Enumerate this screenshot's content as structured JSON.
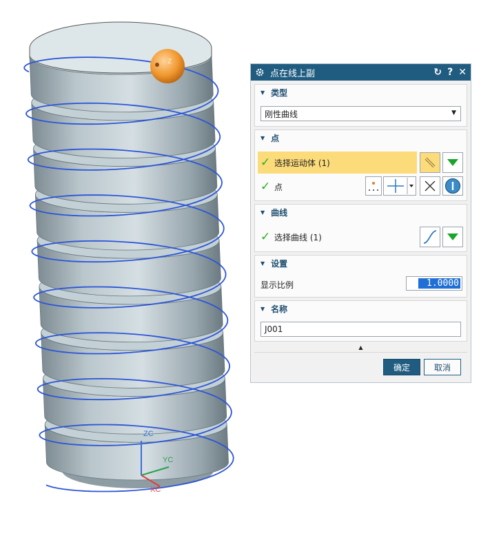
{
  "viewport": {
    "axes": {
      "z": "ZC",
      "y": "YC",
      "x": "XC"
    },
    "marker_text": "Z"
  },
  "dialog": {
    "title": "点在线上副",
    "title_icon": "gear-icon",
    "buttons": {
      "reset": "↻",
      "help": "?",
      "close": "✕"
    },
    "sections": {
      "type": {
        "header": "类型",
        "selected": "刚性曲线"
      },
      "point": {
        "header": "点",
        "select_body_label": "选择运动体 (1)",
        "point_label": "点"
      },
      "curve": {
        "header": "曲线",
        "select_curve_label": "选择曲线 (1)"
      },
      "settings": {
        "header": "设置",
        "scale_label": "显示比例",
        "scale_value": "1.0000"
      },
      "name": {
        "header": "名称",
        "value": "J001"
      }
    },
    "ok_label": "确定",
    "cancel_label": "取消"
  },
  "colors": {
    "title_bar": "#1f5c80",
    "highlight": "#fcdc7a",
    "ok_button": "#1f5c80",
    "check": "#23b023",
    "helix": "#2b55d6",
    "marker": "#f0982e"
  }
}
